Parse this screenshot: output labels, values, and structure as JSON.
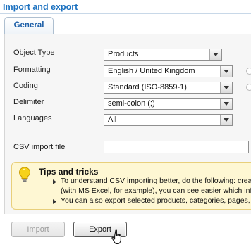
{
  "header": {
    "title": "Import and export"
  },
  "tabs": [
    {
      "label": "General"
    }
  ],
  "form": {
    "object_type": {
      "label": "Object Type",
      "value": "Products"
    },
    "formatting": {
      "label": "Formatting",
      "value": "English / United Kingdom"
    },
    "coding": {
      "label": "Coding",
      "value": "Standard (ISO-8859-1)"
    },
    "delimiter": {
      "label": "Delimiter",
      "value": "semi-colon (;)"
    },
    "languages": {
      "label": "Languages",
      "value": "All"
    },
    "csv_import_file": {
      "label": "CSV import file",
      "value": ""
    }
  },
  "tips": {
    "title": "Tips and tricks",
    "lines": [
      "To understand CSV importing better, do the following: creat",
      "(with MS Excel, for example), you can see easier which inf",
      "You can also export selected products, categories, pages,"
    ]
  },
  "buttons": {
    "import": "Import",
    "export": "Export"
  },
  "icons": {
    "tips": "lightbulb-icon",
    "bullet": "triangle-bullet-icon",
    "cursor": "hand-pointer-icon"
  },
  "colors": {
    "accent": "#1d72c0",
    "tips_bg": "#fef7d3"
  }
}
